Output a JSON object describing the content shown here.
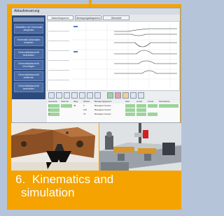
{
  "window": {
    "title": "Ablaufsteuerung"
  },
  "sidebar": {
    "items": [
      "Aktivitäten der Kinematik abspielen",
      "Kinematik Ablaufplan erstellen",
      "Kinematikabschnitt bearbeiten",
      "Kinematikabschnitt hinzufügen",
      "Kinematikabschnitt entfernen",
      "Kinematikabschnitt bearbeiten",
      "Kinematikabschnitt bearbeiten"
    ]
  },
  "tabs": [
    "Ablaufdiagramm",
    "Bewegungsdiagramm",
    "Übersicht"
  ],
  "table": {
    "headers": [
      "Operation",
      "Startzeit",
      "Weg",
      "Winkel",
      "Bewegungsgesetz",
      "Wert",
      "Lineal",
      "Lineal",
      "Schrittweite"
    ],
    "rows": [
      [
        "1",
        "",
        "45",
        "0",
        "Bewegtes Gesetz",
        "",
        "",
        "",
        ""
      ],
      [
        "2",
        "",
        "",
        "125",
        "Bewegtes Gesetz",
        "",
        "",
        "",
        ""
      ],
      [
        "3",
        "",
        "",
        "75",
        "Bewegtes Gesetz",
        "",
        "",
        "",
        ""
      ]
    ]
  },
  "caption": {
    "number": "6.",
    "line1": "Kinematics and",
    "line2": "simulation"
  },
  "colors": {
    "accent": "#f4a300",
    "background": "#b5c4d8",
    "sidebar": "#2d4a7a",
    "highlight": "#9cd49b"
  }
}
